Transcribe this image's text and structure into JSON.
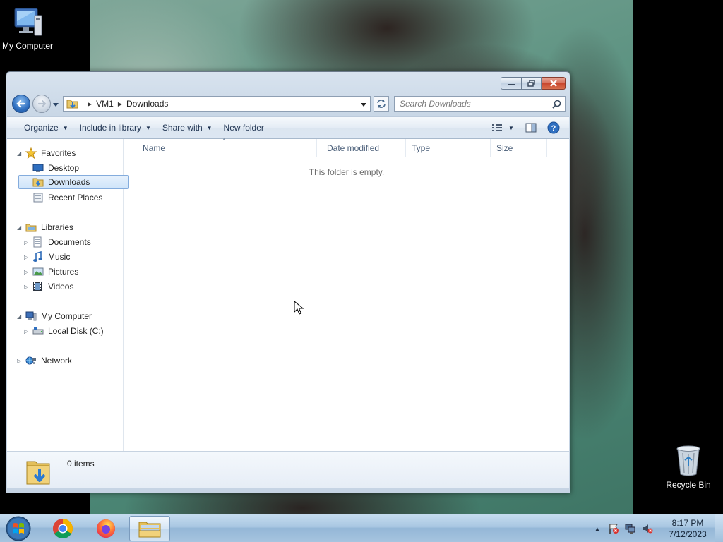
{
  "desktop": {
    "icons": [
      {
        "label": "My Computer",
        "icon": "computer-icon"
      },
      {
        "label": "Recycle Bin",
        "icon": "recycle-bin-icon"
      }
    ]
  },
  "window": {
    "address": {
      "crumbs": [
        "VM1",
        "Downloads"
      ]
    },
    "search": {
      "placeholder": "Search Downloads"
    },
    "command_bar": {
      "organize": "Organize",
      "include_in_library": "Include in library",
      "share_with": "Share with",
      "new_folder": "New folder"
    },
    "nav_pane": {
      "favorites": {
        "label": "Favorites",
        "items": [
          "Desktop",
          "Downloads",
          "Recent Places"
        ],
        "selected": "Downloads"
      },
      "libraries": {
        "label": "Libraries",
        "items": [
          "Documents",
          "Music",
          "Pictures",
          "Videos"
        ]
      },
      "computer": {
        "label": "My Computer",
        "items": [
          "Local Disk (C:)"
        ]
      },
      "network": {
        "label": "Network"
      }
    },
    "columns": [
      "Name",
      "Date modified",
      "Type",
      "Size"
    ],
    "empty_message": "This folder is empty.",
    "details": {
      "item_count": "0 items"
    }
  },
  "taskbar": {
    "pinned": [
      "chrome-icon",
      "firefox-icon",
      "windows-explorer-icon"
    ],
    "active": "windows-explorer-icon",
    "clock": {
      "time": "8:17 PM",
      "date": "7/12/2023"
    }
  }
}
